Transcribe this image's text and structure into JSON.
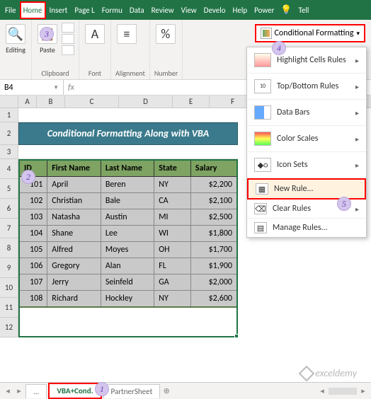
{
  "tabs": {
    "file": "File",
    "home": "Home",
    "insert": "Insert",
    "pagel": "Page L",
    "formu": "Formu",
    "data": "Data",
    "review": "Review",
    "view": "View",
    "develo": "Develo",
    "help": "Help",
    "power": "Power",
    "tell": "Tell"
  },
  "ribbon": {
    "editing": "Editing",
    "paste": "Paste",
    "clipboard": "Clipboard",
    "font": "Font",
    "alignment": "Alignment",
    "number": "Number",
    "cf_label": "Conditional Formatting"
  },
  "cf_menu": {
    "highlight": "Highlight Cells Rules",
    "topbottom": "Top/Bottom Rules",
    "databars": "Data Bars",
    "colorscales": "Color Scales",
    "iconsets": "Icon Sets",
    "newrule": "New Rule...",
    "clearrules": "Clear Rules",
    "managerules": "Manage Rules..."
  },
  "namebox": "B4",
  "columns": {
    "A": "A",
    "B": "B",
    "C": "C",
    "D": "D",
    "E": "E",
    "F": "F"
  },
  "row_nums": [
    "1",
    "2",
    "3",
    "4",
    "5",
    "6",
    "7",
    "8",
    "9",
    "10",
    "11",
    "12"
  ],
  "banner": "Conditional Formatting Along with VBA",
  "headers": {
    "id": "ID",
    "first": "First Name",
    "last": "Last Name",
    "state": "State",
    "salary": "Salary"
  },
  "rows": [
    {
      "id": "101",
      "first": "April",
      "last": "Beren",
      "state": "NY",
      "salary": "$2,200"
    },
    {
      "id": "102",
      "first": "Christian",
      "last": "Bale",
      "state": "CA",
      "salary": "$2,100"
    },
    {
      "id": "103",
      "first": "Natasha",
      "last": "Austin",
      "state": "MI",
      "salary": "$2,500"
    },
    {
      "id": "104",
      "first": "Shane",
      "last": "Lee",
      "state": "WI",
      "salary": "$1,800"
    },
    {
      "id": "105",
      "first": "Alfred",
      "last": "Moyes",
      "state": "OH",
      "salary": "$1,700"
    },
    {
      "id": "106",
      "first": "Gregory",
      "last": "Alan",
      "state": "FL",
      "salary": "$1,900"
    },
    {
      "id": "107",
      "first": "Jerry",
      "last": "Seinfeld",
      "state": "GA",
      "salary": "$2,000"
    },
    {
      "id": "108",
      "first": "Richard",
      "last": "Hockley",
      "state": "NY",
      "salary": "$2,600"
    }
  ],
  "sheets": {
    "dots": "...",
    "active": "VBA+Cond.",
    "partner": "PartnerSheet"
  },
  "watermark": "exceldemy",
  "callouts": {
    "1": "1",
    "2": "2",
    "3": "3",
    "4": "4",
    "5": "5"
  }
}
